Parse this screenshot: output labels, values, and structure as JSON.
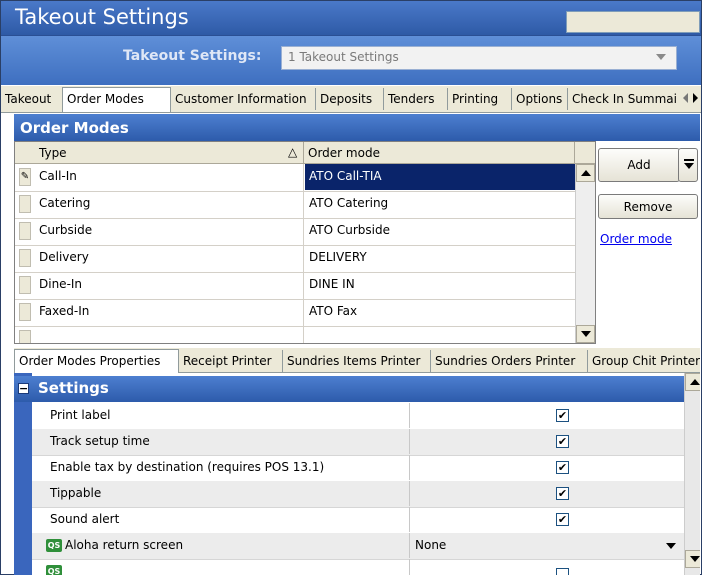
{
  "window": {
    "title": "Takeout Settings"
  },
  "selector": {
    "label": "Takeout Settings:",
    "value": "1 Takeout Settings"
  },
  "tabs": [
    "Takeout",
    "Order Modes",
    "Customer Information",
    "Deposits",
    "Tenders",
    "Printing",
    "Options",
    "Check In Summai"
  ],
  "active_tab": "Order Modes",
  "section": {
    "title": "Order Modes"
  },
  "grid": {
    "columns": {
      "type": "Type",
      "order_mode": "Order mode"
    },
    "rows": [
      {
        "type": "Call-In",
        "order_mode": "ATO Call-TIA",
        "selected": true,
        "marker": "✎"
      },
      {
        "type": "Catering",
        "order_mode": "ATO Catering"
      },
      {
        "type": "Curbside",
        "order_mode": "ATO Curbside"
      },
      {
        "type": "Delivery",
        "order_mode": "DELIVERY"
      },
      {
        "type": "Dine-In",
        "order_mode": "DINE IN"
      },
      {
        "type": "Faxed-In",
        "order_mode": "ATO Fax"
      }
    ],
    "sort_icon": "sort-ascending-icon"
  },
  "actions": {
    "add": "Add",
    "remove": "Remove",
    "link": "Order mode"
  },
  "subtabs": [
    "Order Modes Properties",
    "Receipt Printer",
    "Sundries Items Printer",
    "Sundries Orders Printer",
    "Group Chit Printer"
  ],
  "active_subtab": "Order Modes Properties",
  "properties": {
    "group": "Settings",
    "collapse_symbol": "−",
    "qs_badge": "QS",
    "check": "✔",
    "items": [
      {
        "label": "Print label",
        "checked": true
      },
      {
        "label": "Track setup time",
        "checked": true
      },
      {
        "label": "Enable tax by destination (requires POS 13.1)",
        "checked": true
      },
      {
        "label": "Tippable",
        "checked": true
      },
      {
        "label": "Sound alert",
        "checked": true
      },
      {
        "label": "Aloha return screen",
        "value": "None",
        "qs": true
      }
    ]
  },
  "colors": {
    "header": "#2e5aa6",
    "selection": "#0a246a",
    "tabbar": "#ece9d8"
  }
}
